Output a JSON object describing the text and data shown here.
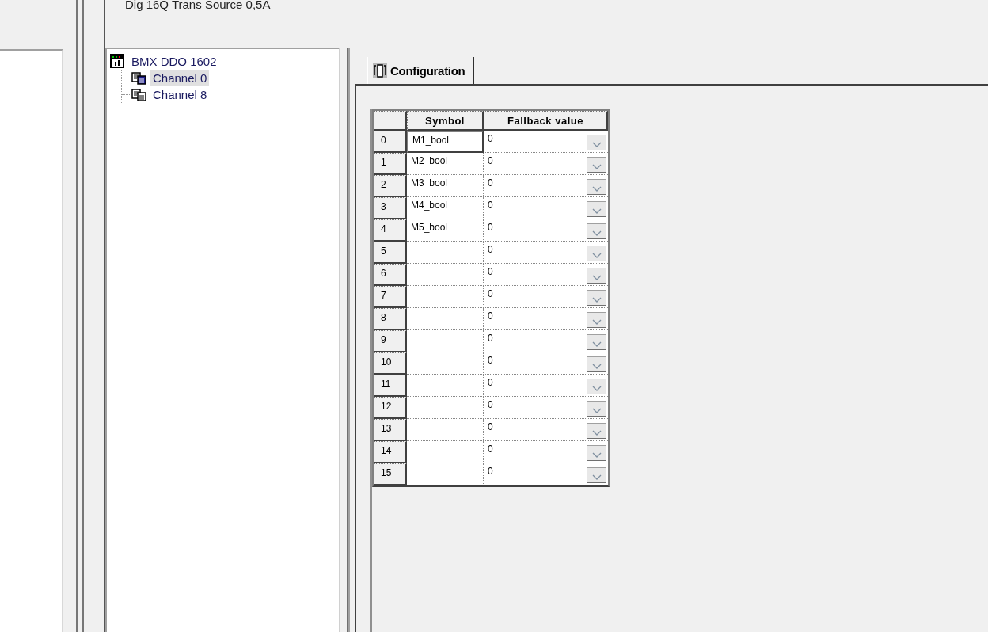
{
  "header": {
    "text": "Dig 16Q Trans Source 0,5A"
  },
  "tree": {
    "label": "BMX DDO 1602",
    "children": [
      {
        "label": "Channel 0",
        "selected": true
      },
      {
        "label": "Channel 8",
        "selected": false
      }
    ]
  },
  "tabs": [
    {
      "label": "Configuration",
      "selected": true
    }
  ],
  "table": {
    "columns": [
      "Symbol",
      "Fallback value"
    ],
    "rows": [
      {
        "index": "0",
        "symbol": "M1_bool",
        "value": "0",
        "selected": true
      },
      {
        "index": "1",
        "symbol": "M2_bool",
        "value": "0",
        "selected": false
      },
      {
        "index": "2",
        "symbol": "M3_bool",
        "value": "0",
        "selected": false
      },
      {
        "index": "3",
        "symbol": "M4_bool",
        "value": "0",
        "selected": false
      },
      {
        "index": "4",
        "symbol": "M5_bool",
        "value": "0",
        "selected": false
      },
      {
        "index": "5",
        "value": "0",
        "selected": false
      },
      {
        "index": "6",
        "value": "0",
        "selected": false
      },
      {
        "index": "7",
        "value": "0",
        "selected": false
      },
      {
        "index": "8",
        "value": "0",
        "selected": false
      },
      {
        "index": "9",
        "value": "0",
        "selected": false
      },
      {
        "index": "10",
        "value": "0",
        "selected": false
      },
      {
        "index": "11",
        "value": "0",
        "selected": false
      },
      {
        "index": "12",
        "value": "0",
        "selected": false
      },
      {
        "index": "13",
        "value": "0",
        "selected": false
      },
      {
        "index": "14",
        "value": "0",
        "selected": false
      },
      {
        "index": "15",
        "value": "0",
        "selected": false
      }
    ]
  }
}
